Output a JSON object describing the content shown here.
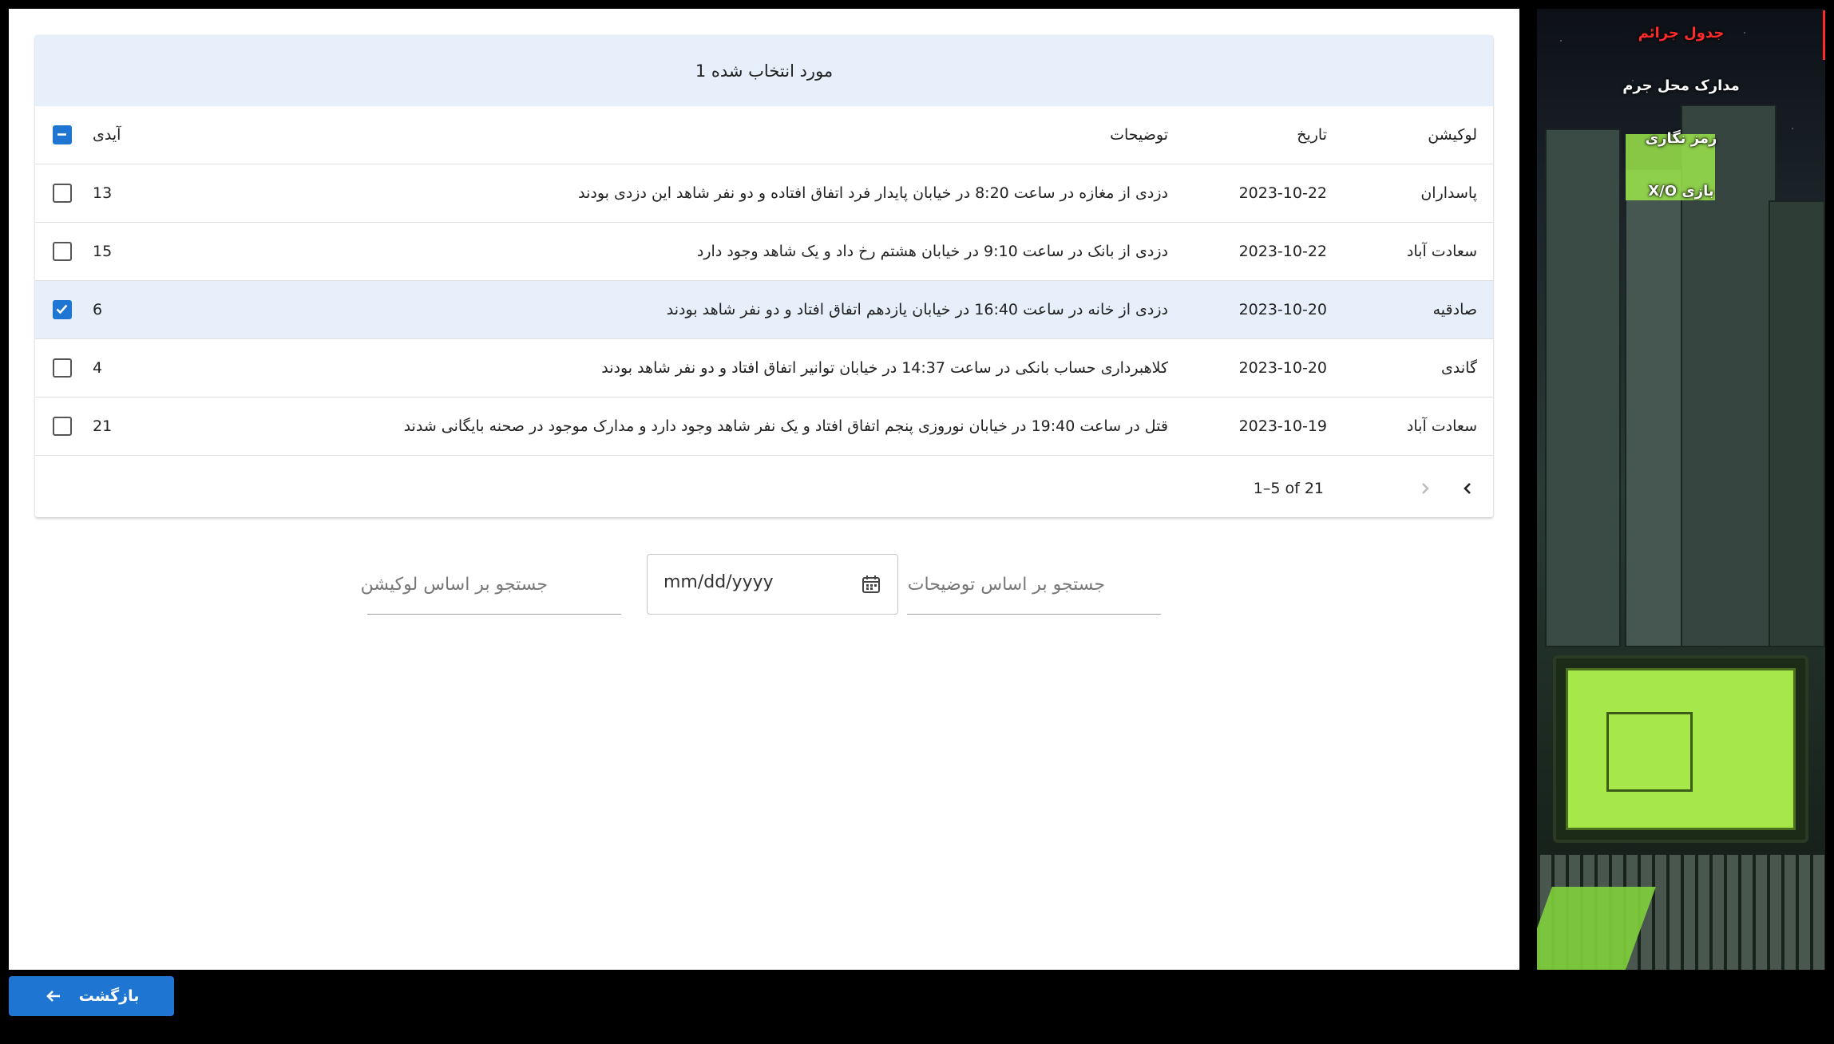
{
  "selection_bar": "مورد انتخاب شده 1",
  "table": {
    "headers": {
      "location": "لوکیشن",
      "date": "تاریخ",
      "description": "توضیحات",
      "id": "آیدی"
    },
    "rows": [
      {
        "location": "پاسداران",
        "date": "2023-10-22",
        "description": "دزدی از مغازه در ساعت 8:20 در خیابان پایدار فرد اتفاق افتاده و دو نفر شاهد این دزدی بودند",
        "id": "13",
        "checked": false
      },
      {
        "location": "سعادت آباد",
        "date": "2023-10-22",
        "description": "دزدی از بانک در ساعت 9:10 در خیابان هشتم رخ داد و یک شاهد وجود دارد",
        "id": "15",
        "checked": false
      },
      {
        "location": "صادقیه",
        "date": "2023-10-20",
        "description": "دزدی از خانه در ساعت 16:40 در خیابان یازدهم اتفاق افتاد و دو نفر شاهد بودند",
        "id": "6",
        "checked": true
      },
      {
        "location": "گاندی",
        "date": "2023-10-20",
        "description": "کلاهبرداری حساب بانکی در ساعت 14:37 در خیابان توانیر اتفاق افتاد و دو نفر شاهد بودند",
        "id": "4",
        "checked": false
      },
      {
        "location": "سعادت آباد",
        "date": "2023-10-19",
        "description": "قتل در ساعت 19:40 در خیابان نوروزی پنجم اتفاق افتاد و یک نفر شاهد وجود دارد و مدارک موجود در صحنه بایگانی شدند",
        "id": "21",
        "checked": false
      }
    ],
    "pagination": "1–5 of 21"
  },
  "filters": {
    "description_placeholder": "جستجو بر اساس توضیحات",
    "date_placeholder": "mm/dd/yyyy",
    "location_placeholder": "جستجو بر اساس لوکیشن"
  },
  "sidebar": {
    "items": [
      {
        "label": "جدول جرائم",
        "active": true
      },
      {
        "label": "مدارک محل جرم",
        "active": false
      },
      {
        "label": "رمز نگاری",
        "active": false
      },
      {
        "label": "بازی X/O",
        "active": false
      }
    ],
    "accent": "#ff2a2a"
  },
  "back_button": {
    "label": "بازگشت",
    "icon": "arrow-left-icon"
  },
  "colors": {
    "primary": "#1f76d2",
    "selected_row": "#e6effa"
  }
}
